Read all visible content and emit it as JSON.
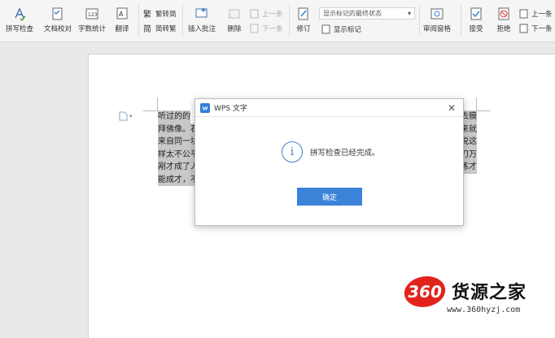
{
  "ribbon": {
    "spell_check": "拼写检查",
    "doc_proof": "文档校对",
    "word_count": "字数统计",
    "translate": "翻译",
    "trad_simp": "繁转简",
    "simp_trad": "简转繁",
    "insert_comment": "插入批注",
    "delete": "删除",
    "prev_comment": "上一条",
    "next_comment": "下一条",
    "track_changes": "修订",
    "show_markup_dropdown": "显示标记的最终状态",
    "show_markup": "显示标记",
    "review_pane": "审阅窗格",
    "accept": "接受",
    "reject": "拒绝",
    "prev_change": "上一条",
    "next_change": "下一条"
  },
  "document": {
    "lines": [
      {
        "left": "听过的的",
        "right": "去膜"
      },
      {
        "left": "拜佛像。石",
        "right": "来就"
      },
      {
        "left": "来自同一块",
        "right": "说这"
      },
      {
        "left": "样太不公平",
        "right": "刀万"
      },
      {
        "left": "剐才成了人",
        "right": "练才"
      },
      {
        "left": "能成才，不",
        "right": ""
      }
    ]
  },
  "dialog": {
    "title": "WPS 文字",
    "message": "拼写检查已经完成。",
    "ok_label": "确定"
  },
  "watermark": {
    "badge": "360",
    "name": "货源之家",
    "url": "www.360hyzj.com"
  },
  "colors": {
    "accent": "#3b82d9",
    "watermark_red": "#e2231a",
    "highlight": "#c8c8c8"
  }
}
